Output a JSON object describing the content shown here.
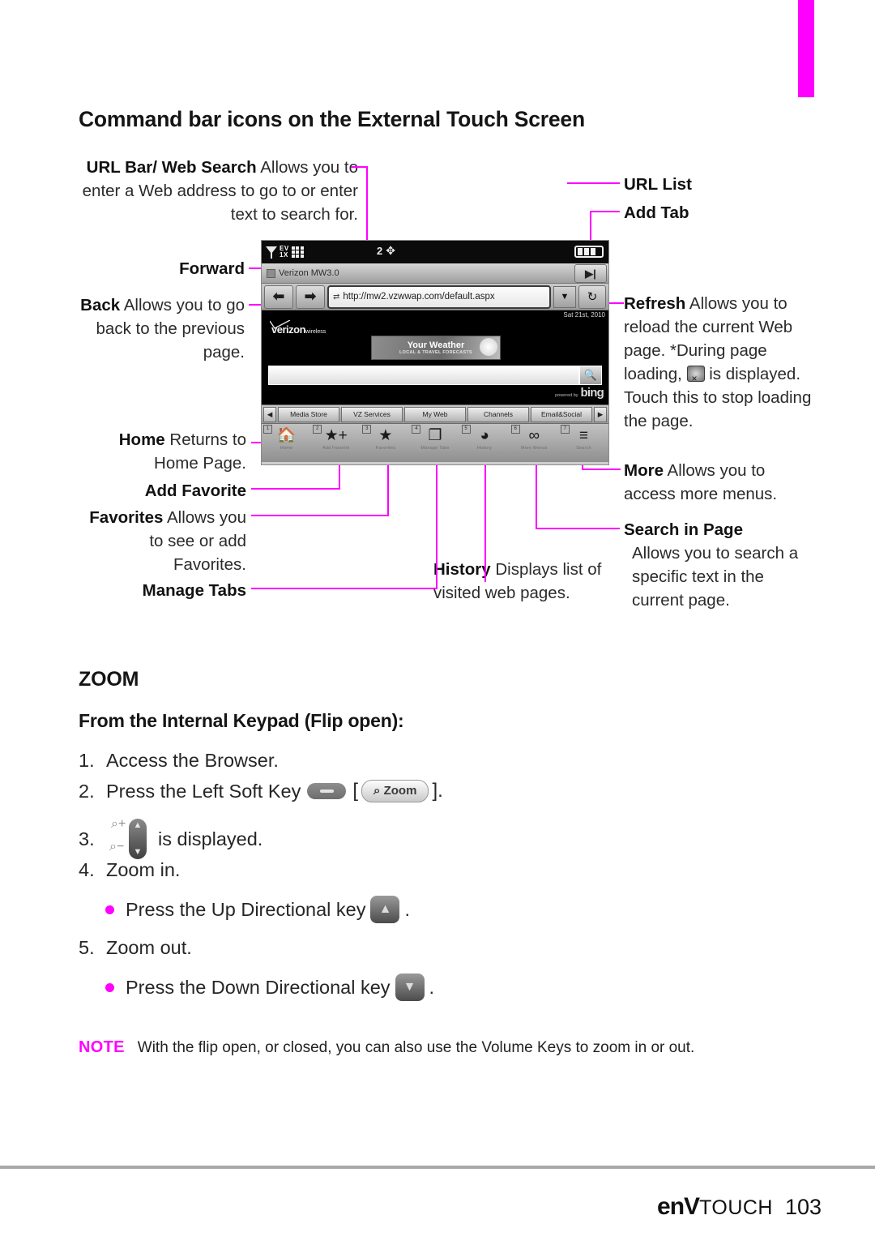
{
  "page": {
    "title": "Command bar icons on the External Touch Screen",
    "number": "103",
    "brand": "enV",
    "brand_suffix": "TOUCH",
    "accent_color": "#ff00ff"
  },
  "callouts": {
    "url_bar": {
      "term": "URL Bar/ Web Search",
      "desc": " Allows you to enter a Web address to go to or enter text to search for."
    },
    "forward": {
      "term": "Forward",
      "desc": ""
    },
    "back": {
      "term": "Back",
      "desc": " Allows you to go back to the previous page."
    },
    "home": {
      "term": "Home",
      "desc": " Returns to Home Page."
    },
    "add_favorite": {
      "term": "Add Favorite",
      "desc": ""
    },
    "favorites": {
      "term": "Favorites",
      "desc": " Allows you to see or add Favorites."
    },
    "manage_tabs": {
      "term": "Manage Tabs",
      "desc": ""
    },
    "url_list": {
      "term": "URL List",
      "desc": ""
    },
    "add_tab": {
      "term": "Add Tab",
      "desc": ""
    },
    "refresh": {
      "term": "Refresh",
      "desc_a": " Allows you to reload the current Web page. *During page loading, ",
      "desc_b": " is displayed. Touch this to stop loading the page."
    },
    "more": {
      "term": "More",
      "desc": " Allows you to access more menus."
    },
    "search_in_page": {
      "term": "Search in Page",
      "desc": "Allows you to search a specific text in the current page."
    },
    "history": {
      "term": "History",
      "desc": " Displays list of visited web pages."
    }
  },
  "phone": {
    "status": {
      "network_a": "EV",
      "network_b": "1X",
      "roam": "2"
    },
    "tab_label": "Verizon MW3.0",
    "url": "http://mw2.vzwwap.com/default.aspx",
    "date": "Sat 21st, 2010",
    "logo": "verizon",
    "logo_sub": "wireless",
    "banner_title": "Your Weather",
    "banner_sub": "LOCAL & TRAVEL FORECASTS",
    "search_value": "",
    "powered_by": "powered by",
    "search_engine": "bing",
    "site_tabs": [
      "Media Store",
      "VZ Services",
      "My Web",
      "Channels",
      "Email&Social"
    ],
    "command_bar": [
      {
        "num": "1",
        "icon": "home-icon",
        "glyph": "⌂",
        "caption": "Home"
      },
      {
        "num": "2",
        "icon": "add-favorite-icon",
        "glyph": "★",
        "caption": "Add Favorite"
      },
      {
        "num": "3",
        "icon": "favorites-icon",
        "glyph": "★",
        "caption": "Favorites"
      },
      {
        "num": "4",
        "icon": "manage-tabs-icon",
        "glyph": "❐",
        "caption": "Manage Tabs"
      },
      {
        "num": "5",
        "icon": "history-icon",
        "glyph": "◔",
        "caption": "History"
      },
      {
        "num": "6",
        "icon": "more-icon",
        "glyph": "∞",
        "caption": "More Menus"
      },
      {
        "num": "7",
        "icon": "search-in-page-icon",
        "glyph": "≡",
        "caption": "Search"
      }
    ]
  },
  "zoom_section": {
    "heading": "ZOOM",
    "subheading": "From the Internal Keypad (Flip open):",
    "steps": {
      "s1_no": "1.",
      "s1_text": "Access the Browser.",
      "s2_no": "2.",
      "s2_text": "Press the Left Soft Key",
      "s2_bracket_open": "[",
      "s2_button": "Zoom",
      "s2_bracket_close": "].",
      "s3_no": "3.",
      "s3_text": "is displayed.",
      "s4_no": "4.",
      "s4_text": "Zoom in.",
      "s4_bullet": "Press the Up Directional key",
      "s4_period": ".",
      "s5_no": "5.",
      "s5_text": "Zoom out.",
      "s5_bullet": "Press the Down Directional key",
      "s5_period": "."
    }
  },
  "note": {
    "label": "NOTE",
    "text": "With the flip open, or closed, you can also use the Volume Keys to zoom in or out."
  }
}
